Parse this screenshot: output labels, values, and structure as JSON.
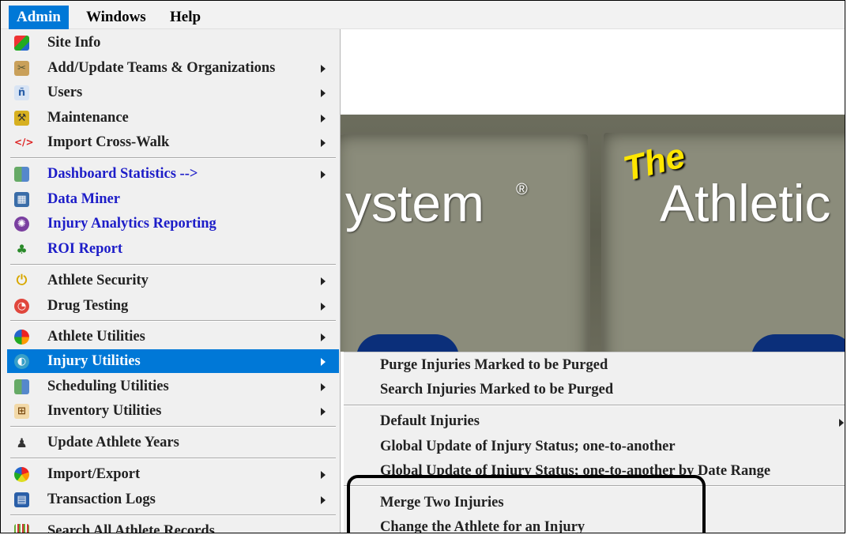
{
  "menubar": {
    "items": [
      "Admin",
      "Windows",
      "Help"
    ]
  },
  "banner": {
    "text_left": "ystem",
    "registered": "®",
    "the": "The",
    "text_right": "Athletic"
  },
  "admin_menu": {
    "items": [
      {
        "label": "Site Info",
        "icon": "site-info-icon",
        "submenu": false
      },
      {
        "label": "Add/Update Teams & Organizations",
        "icon": "teams-icon",
        "submenu": true
      },
      {
        "label": "Users",
        "icon": "users-icon",
        "submenu": true
      },
      {
        "label": "Maintenance",
        "icon": "maintenance-icon",
        "submenu": true
      },
      {
        "label": "Import Cross-Walk",
        "icon": "code-icon",
        "submenu": true
      },
      {
        "label": "Dashboard Statistics -->",
        "icon": "dashboard-icon",
        "submenu": true
      },
      {
        "label": "Data Miner",
        "icon": "data-miner-icon",
        "submenu": false
      },
      {
        "label": "Injury Analytics Reporting",
        "icon": "analytics-icon",
        "submenu": false
      },
      {
        "label": "ROI Report",
        "icon": "roi-icon",
        "submenu": false
      },
      {
        "label": "Athlete Security",
        "icon": "security-icon",
        "submenu": true
      },
      {
        "label": "Drug Testing",
        "icon": "drug-testing-icon",
        "submenu": true
      },
      {
        "label": "Athlete Utilities",
        "icon": "athlete-utilities-icon",
        "submenu": true
      },
      {
        "label": "Injury Utilities",
        "icon": "injury-utilities-icon",
        "submenu": true
      },
      {
        "label": "Scheduling Utilities",
        "icon": "scheduling-icon",
        "submenu": true
      },
      {
        "label": "Inventory Utilities",
        "icon": "inventory-icon",
        "submenu": true
      },
      {
        "label": "Update Athlete Years",
        "icon": "graduate-icon",
        "submenu": false
      },
      {
        "label": "Import/Export",
        "icon": "import-export-icon",
        "submenu": true
      },
      {
        "label": "Transaction Logs",
        "icon": "transaction-log-icon",
        "submenu": true
      },
      {
        "label": "Search All Athlete Records",
        "icon": "barcode-icon",
        "submenu": false
      }
    ]
  },
  "injury_submenu": {
    "items": [
      {
        "label": "Purge Injuries Marked to be Purged",
        "submenu": false
      },
      {
        "label": "Search Injuries Marked to be Purged",
        "submenu": false
      },
      {
        "label": "Default Injuries",
        "submenu": true
      },
      {
        "label": "Global Update of Injury Status; one-to-another",
        "submenu": false
      },
      {
        "label": "Global Update of Injury Status; one-to-another by Date Range",
        "submenu": false
      },
      {
        "label": "Merge Two Injuries",
        "submenu": false
      },
      {
        "label": "Change the Athlete for an Injury",
        "submenu": false
      }
    ]
  },
  "colors": {
    "highlight": "#0078d7",
    "link_blue": "#1d1dc8",
    "menu_bg": "#f0f0f0"
  }
}
